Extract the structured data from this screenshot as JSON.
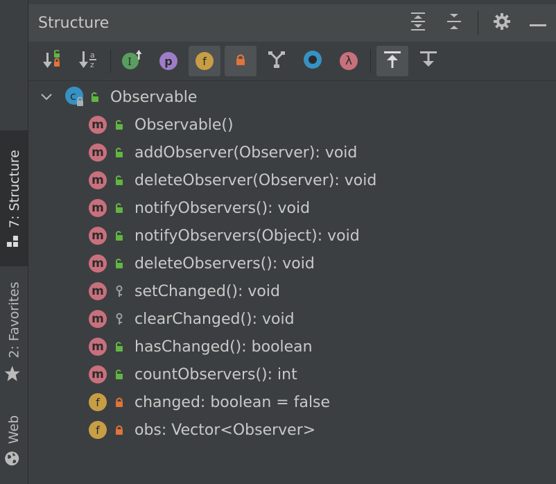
{
  "panel": {
    "title": "Structure"
  },
  "sidebar": {
    "tabs": [
      {
        "label": "7: Structure",
        "icon": "structure-icon",
        "active": true
      },
      {
        "label": "2: Favorites",
        "icon": "star-icon",
        "active": false
      },
      {
        "label": "Web",
        "icon": "globe-icon",
        "active": false
      }
    ]
  },
  "header_buttons": [
    "expand-all-icon",
    "collapse-all-icon",
    "gear-icon",
    "minimize-icon"
  ],
  "toolbar": {
    "buttons": [
      {
        "name": "sort-by-visibility",
        "icon": "sort-visibility-icon",
        "active": false
      },
      {
        "name": "sort-alphabetically",
        "icon": "sort-alpha-icon",
        "active": false,
        "glyph": "a z"
      },
      {
        "name": "show-inherited",
        "icon": "inherited-icon",
        "glyph": "I",
        "active": false
      },
      {
        "name": "show-properties",
        "icon": "property-icon",
        "glyph": "p",
        "active": false
      },
      {
        "name": "show-fields",
        "icon": "field-icon",
        "glyph": "f",
        "active": true
      },
      {
        "name": "show-non-public",
        "icon": "lock-icon",
        "active": true
      },
      {
        "name": "show-interfaces",
        "icon": "fork-icon",
        "active": false
      },
      {
        "name": "show-anonymous",
        "icon": "anonymous-class-icon",
        "active": false
      },
      {
        "name": "show-lambdas",
        "icon": "lambda-icon",
        "glyph": "λ",
        "active": false
      },
      {
        "name": "autoscroll-to-source",
        "icon": "autoscroll-to-source-icon",
        "active": true
      },
      {
        "name": "autoscroll-from-source",
        "icon": "autoscroll-from-source-icon",
        "active": false
      }
    ]
  },
  "tree": {
    "root": {
      "label": "Observable",
      "kind": "class",
      "badge": "c",
      "visibility": "public",
      "expanded": true
    },
    "items": [
      {
        "label": "Observable()",
        "kind": "method",
        "badge": "m",
        "visibility": "public"
      },
      {
        "label": "addObserver(Observer): void",
        "kind": "method",
        "badge": "m",
        "visibility": "public"
      },
      {
        "label": "deleteObserver(Observer): void",
        "kind": "method",
        "badge": "m",
        "visibility": "public"
      },
      {
        "label": "notifyObservers(): void",
        "kind": "method",
        "badge": "m",
        "visibility": "public"
      },
      {
        "label": "notifyObservers(Object): void",
        "kind": "method",
        "badge": "m",
        "visibility": "public"
      },
      {
        "label": "deleteObservers(): void",
        "kind": "method",
        "badge": "m",
        "visibility": "public"
      },
      {
        "label": "setChanged(): void",
        "kind": "method",
        "badge": "m",
        "visibility": "protected"
      },
      {
        "label": "clearChanged(): void",
        "kind": "method",
        "badge": "m",
        "visibility": "protected"
      },
      {
        "label": "hasChanged(): boolean",
        "kind": "method",
        "badge": "m",
        "visibility": "public"
      },
      {
        "label": "countObservers(): int",
        "kind": "method",
        "badge": "m",
        "visibility": "public"
      },
      {
        "label": "changed: boolean = false",
        "kind": "field",
        "badge": "f",
        "visibility": "private"
      },
      {
        "label": "obs: Vector<Observer>",
        "kind": "field",
        "badge": "f",
        "visibility": "private"
      }
    ]
  },
  "colors": {
    "method": "#c9707d",
    "field": "#c89e45",
    "class": "#3592c4",
    "public": "#62b543",
    "private": "#e0743a",
    "protected": "#9aa0a6"
  }
}
